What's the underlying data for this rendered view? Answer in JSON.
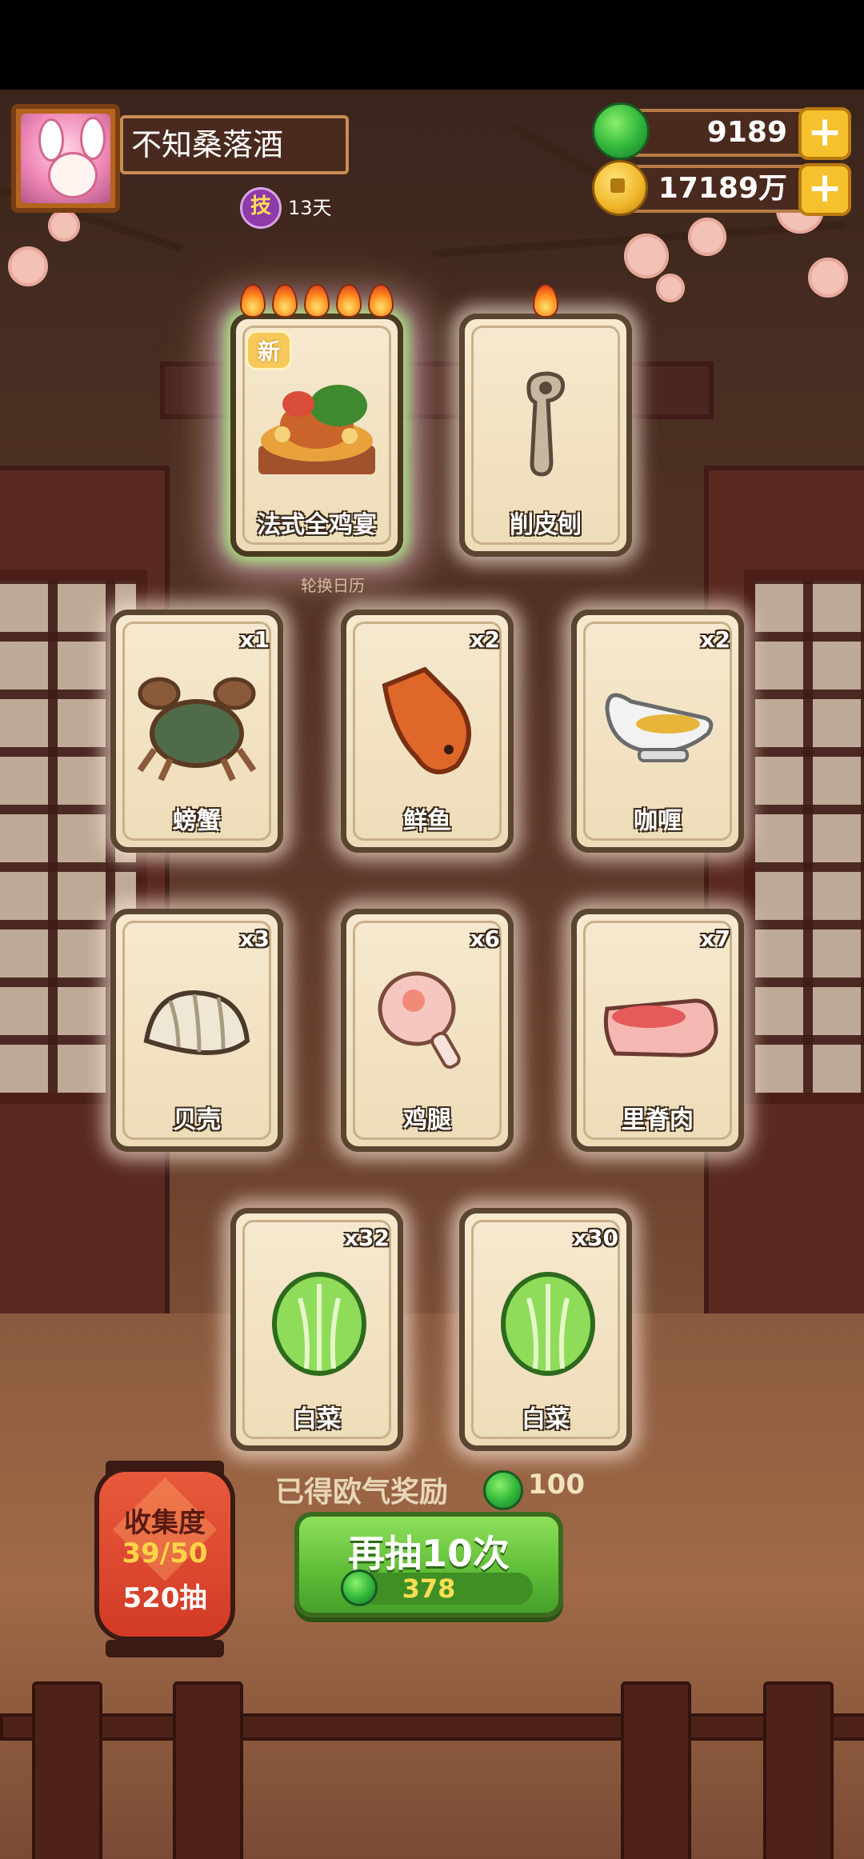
{
  "player": {
    "name": "不知桑落酒",
    "skill_badge": "技",
    "skill_days": "13天"
  },
  "currency": {
    "gems": "9189",
    "coins": "17189万",
    "add_symbol": "+"
  },
  "featured_cards": [
    {
      "name": "法式全鸡宴",
      "tag": "新",
      "flames": 5,
      "art_icon": "feast-icon"
    },
    {
      "name": "削皮刨",
      "flames": 1,
      "art_icon": "peeler-icon"
    }
  ],
  "featured_caption": "轮换日历",
  "cards": [
    {
      "name": "螃蟹",
      "count": "x1",
      "art_icon": "crab-icon"
    },
    {
      "name": "鲜鱼",
      "count": "x2",
      "art_icon": "fish-icon"
    },
    {
      "name": "咖喱",
      "count": "x2",
      "art_icon": "curry-icon"
    },
    {
      "name": "贝壳",
      "count": "x3",
      "art_icon": "shell-icon"
    },
    {
      "name": "鸡腿",
      "count": "x6",
      "art_icon": "drumstick-icon"
    },
    {
      "name": "里脊肉",
      "count": "x7",
      "art_icon": "tenderloin-icon"
    },
    {
      "name": "白菜",
      "count": "x32",
      "art_icon": "cabbage-icon"
    },
    {
      "name": "白菜",
      "count": "x30",
      "art_icon": "cabbage-icon"
    }
  ],
  "collection": {
    "title": "收集度",
    "progress": "39/50",
    "draws": "520抽"
  },
  "reward": {
    "label": "已得欧气奖励",
    "value": "100"
  },
  "draw_button": {
    "label": "再抽10次",
    "cost": "378"
  },
  "colors": {
    "gem_green": "#2fb43a",
    "coin_gold": "#f0b428",
    "button_green": "#5dbb36",
    "card_bg": "#f6e9cf"
  }
}
